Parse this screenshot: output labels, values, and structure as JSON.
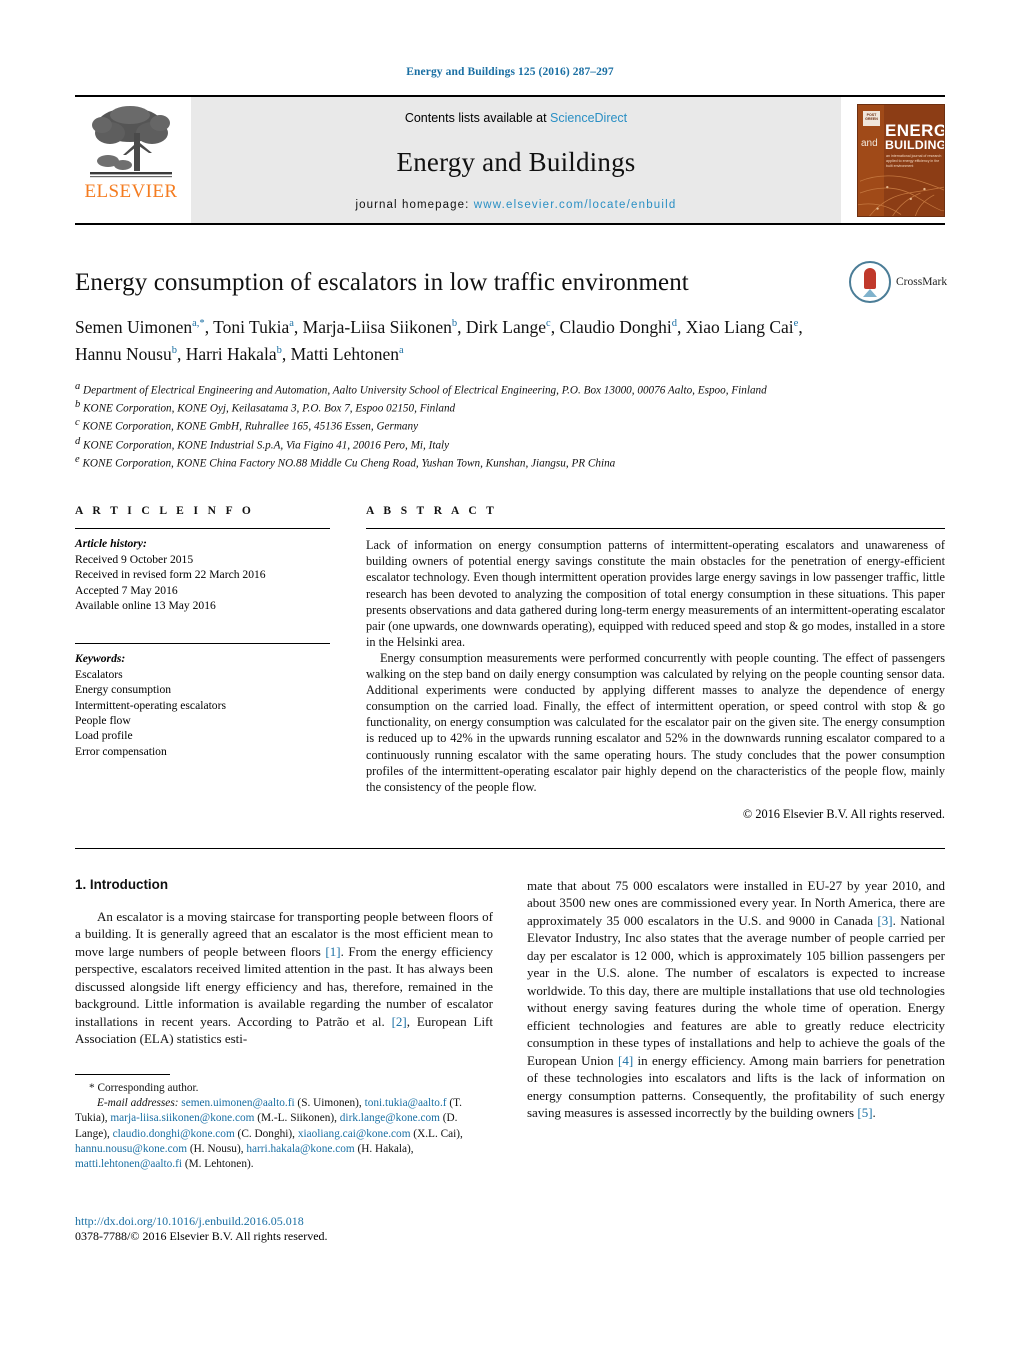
{
  "running_head": "Energy and Buildings 125 (2016) 287–297",
  "masthead": {
    "publisher_name": "ELSEVIER",
    "contents_prefix": "Contents lists available at ",
    "contents_link": "ScienceDirect",
    "journal_title": "Energy and Buildings",
    "homepage_prefix": "journal homepage: ",
    "homepage_url": "www.elsevier.com/locate/enbuild",
    "cover": {
      "badge": "POST GREEN",
      "and": "and",
      "energy": "ENERGY",
      "buildings": "BUILDINGS",
      "subtitle": "an international journal of research applied to energy efficiency in the built environment"
    }
  },
  "article": {
    "title": "Energy consumption of escalators in low traffic environment",
    "crossmark_label": "CrossMark",
    "authors": [
      {
        "name": "Semen Uimonen",
        "marks": "a,*"
      },
      {
        "name": "Toni Tukia",
        "marks": "a"
      },
      {
        "name": "Marja-Liisa Siikonen",
        "marks": "b"
      },
      {
        "name": "Dirk Lange",
        "marks": "c"
      },
      {
        "name": "Claudio Donghi",
        "marks": "d"
      },
      {
        "name": "Xiao Liang Cai",
        "marks": "e"
      },
      {
        "name": "Hannu Nousu",
        "marks": "b"
      },
      {
        "name": "Harri Hakala",
        "marks": "b"
      },
      {
        "name": "Matti Lehtonen",
        "marks": "a"
      }
    ],
    "affiliations": [
      {
        "mark": "a",
        "text": "Department of Electrical Engineering and Automation, Aalto University School of Electrical Engineering, P.O. Box 13000, 00076 Aalto, Espoo, Finland"
      },
      {
        "mark": "b",
        "text": "KONE Corporation, KONE Oyj, Keilasatama 3, P.O. Box 7, Espoo 02150, Finland"
      },
      {
        "mark": "c",
        "text": "KONE Corporation, KONE GmbH, Ruhrallee 165, 45136 Essen, Germany"
      },
      {
        "mark": "d",
        "text": "KONE Corporation, KONE Industrial S.p.A, Via Figino 41, 20016 Pero, Mi, Italy"
      },
      {
        "mark": "e",
        "text": "KONE Corporation, KONE China Factory NO.88 Middle Cu Cheng Road, Yushan Town, Kunshan, Jiangsu, PR China"
      }
    ]
  },
  "article_info": {
    "heading": "A R T I C L E   I N F O",
    "history_label": "Article history:",
    "history": [
      "Received 9 October 2015",
      "Received in revised form 22 March 2016",
      "Accepted 7 May 2016",
      "Available online 13 May 2016"
    ],
    "keywords_label": "Keywords:",
    "keywords": [
      "Escalators",
      "Energy consumption",
      "Intermittent-operating escalators",
      "People flow",
      "Load profile",
      "Error compensation"
    ]
  },
  "abstract": {
    "heading": "A B S T R A C T",
    "paragraphs": [
      "Lack of information on energy consumption patterns of intermittent-operating escalators and unawareness of building owners of potential energy savings constitute the main obstacles for the penetration of energy-efficient escalator technology. Even though intermittent operation provides large energy savings in low passenger traffic, little research has been devoted to analyzing the composition of total energy consumption in these situations. This paper presents observations and data gathered during long-term energy measurements of an intermittent-operating escalator pair (one upwards, one downwards operating), equipped with reduced speed and stop & go modes, installed in a store in the Helsinki area.",
      "Energy consumption measurements were performed concurrently with people counting. The effect of passengers walking on the step band on daily energy consumption was calculated by relying on the people counting sensor data. Additional experiments were conducted by applying different masses to analyze the dependence of energy consumption on the carried load. Finally, the effect of intermittent operation, or speed control with stop & go functionality, on energy consumption was calculated for the escalator pair on the given site. The energy consumption is reduced up to 42% in the upwards running escalator and 52% in the downwards running escalator compared to a continuously running escalator with the same operating hours. The study concludes that the power consumption profiles of the intermittent-operating escalator pair highly depend on the characteristics of the people flow, mainly the consistency of the people flow."
    ],
    "copyright": "© 2016 Elsevier B.V. All rights reserved."
  },
  "introduction": {
    "section_number": "1.",
    "section_title": "Introduction",
    "left_paragraph_part1": "An escalator is a moving staircase for transporting people between floors of a building. It is generally agreed that an escalator is the most efficient mean to move large numbers of people between floors ",
    "ref1": "[1]",
    "left_paragraph_part2": ". From the energy efficiency perspective, escalators received limited attention in the past. It has always been discussed alongside lift energy efficiency and has, therefore, remained in the background. Little information is available regarding the number of escalator installations in recent years. According to Patrão et al. ",
    "ref2": "[2]",
    "left_paragraph_part3": ", European Lift Association (ELA) statistics esti-",
    "right_part1": "mate that about 75 000 escalators were installed in EU-27 by year 2010, and about 3500 new ones are commissioned every year. In North America, there are approximately 35 000 escalators in the U.S. and 9000 in Canada ",
    "ref3": "[3]",
    "right_part2": ". National Elevator Industry, Inc also states that the average number of people carried per day per escalator is 12 000, which is approximately 105 billion passengers per year in the U.S. alone. The number of escalators is expected to increase worldwide. To this day, there are multiple installations that use old technologies without energy saving features during the whole time of operation. Energy efficient technologies and features are able to greatly reduce electricity consumption in these types of installations and help to achieve the goals of the European Union ",
    "ref4": "[4]",
    "right_part3": " in energy efficiency. Among main barriers for penetration of these technologies into escalators and lifts is the lack of information on energy consumption patterns. Consequently, the profitability of such energy saving measures is assessed incorrectly by the building owners ",
    "ref5": "[5]",
    "right_part4": "."
  },
  "footnote": {
    "corresponding": "* Corresponding author.",
    "email_label": "E-mail addresses:",
    "entries": [
      {
        "email": "semen.uimonen@aalto.fi",
        "who": " (S. Uimonen), "
      },
      {
        "email": "toni.tukia@aalto.f",
        "who": " (T. Tukia), "
      },
      {
        "email": "marja-liisa.siikonen@kone.com",
        "who": " (M.-L. Siikonen), "
      },
      {
        "email": "dirk.lange@kone.com",
        "who": " (D. Lange), "
      },
      {
        "email": "claudio.donghi@kone.com",
        "who": " (C. Donghi), "
      },
      {
        "email": "xiaoliang.cai@kone.com",
        "who": " (X.L. Cai), "
      },
      {
        "email": "hannu.nousu@kone.com",
        "who": " (H. Nousu), "
      },
      {
        "email": "harri.hakala@kone.com",
        "who": " (H. Hakala), "
      },
      {
        "email": "matti.lehtonen@aalto.fi",
        "who": " (M. Lehtonen)."
      }
    ]
  },
  "publication_footer": {
    "doi": "http://dx.doi.org/10.1016/j.enbuild.2016.05.018",
    "issn": "0378-7788/© 2016 Elsevier B.V. All rights reserved."
  },
  "colors": {
    "link_blue": "#1a6fa3",
    "sciencedirect_blue": "#2a8fc4",
    "elsevier_orange": "#f47c20",
    "cover_brown": "#8c3d15"
  }
}
